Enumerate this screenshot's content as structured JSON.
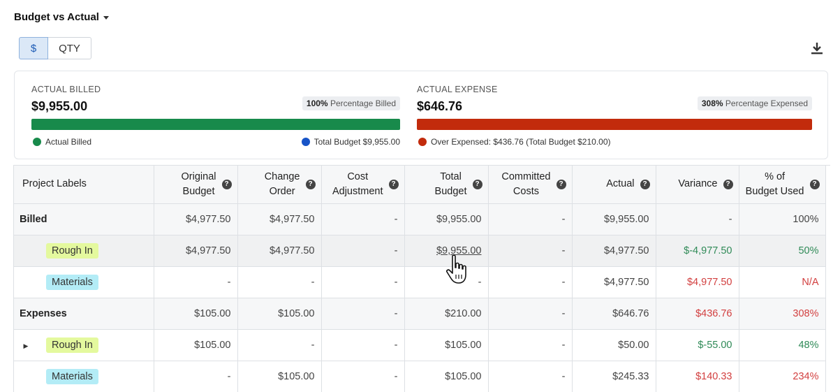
{
  "header": {
    "view_title": "Budget vs Actual"
  },
  "toggle": {
    "dollar_label": "$",
    "qty_label": "QTY",
    "selected": "$"
  },
  "icons": {
    "download": "download-icon",
    "help": "help-icon",
    "cursor": "pointer-hand-icon"
  },
  "summary": {
    "billed": {
      "label": "ACTUAL BILLED",
      "value": "$9,955.00",
      "badge_pct": "100%",
      "badge_text": "Percentage Billed",
      "progress": 1.0,
      "bar_color": "#188a4b",
      "legend_left": "Actual Billed",
      "legend_left_color": "#188a4b",
      "legend_right": "Total Budget $9,955.00",
      "legend_right_color": "#1754c7"
    },
    "expense": {
      "label": "ACTUAL EXPENSE",
      "value": "$646.76",
      "badge_pct": "308%",
      "badge_text": "Percentage Expensed",
      "progress": 1.0,
      "bar_color": "#c22b0c",
      "legend_left": "Over Expensed: $436.76 (Total Budget $210.00)",
      "legend_left_color": "#c22b0c"
    }
  },
  "table": {
    "columns": [
      {
        "label": "Project Labels",
        "help": false
      },
      {
        "label": "Original\nBudget",
        "help": true
      },
      {
        "label": "Change\nOrder",
        "help": true
      },
      {
        "label": "Cost\nAdjustment",
        "help": true
      },
      {
        "label": "Total\nBudget",
        "help": true
      },
      {
        "label": "Committed\nCosts",
        "help": true
      },
      {
        "label": "Actual",
        "help": true
      },
      {
        "label": "Variance",
        "help": true
      },
      {
        "label": "% of\nBudget Used",
        "help": true
      }
    ],
    "rows": [
      {
        "type": "group",
        "label": "Billed",
        "cells": [
          "$4,977.50",
          "$4,977.50",
          "-",
          "$9,955.00",
          "-",
          "$9,955.00",
          "-",
          "100%"
        ],
        "variance_tone": "",
        "pct_tone": ""
      },
      {
        "type": "child",
        "label": "Rough In",
        "tag": "rough",
        "hover": true,
        "link_col": 3,
        "cells": [
          "$4,977.50",
          "$4,977.50",
          "-",
          "$9,955.00",
          "-",
          "$4,977.50",
          "$-4,977.50",
          "50%"
        ],
        "variance_tone": "pos",
        "pct_tone": "pos"
      },
      {
        "type": "child",
        "label": "Materials",
        "tag": "mat",
        "cells": [
          "-",
          "-",
          "-",
          "-",
          "-",
          "$4,977.50",
          "$4,977.50",
          "N/A"
        ],
        "variance_tone": "neg",
        "pct_tone": "neg"
      },
      {
        "type": "group",
        "label": "Expenses",
        "cells": [
          "$105.00",
          "$105.00",
          "-",
          "$210.00",
          "-",
          "$646.76",
          "$436.76",
          "308%"
        ],
        "variance_tone": "neg",
        "pct_tone": "neg"
      },
      {
        "type": "child",
        "label": "Rough In",
        "tag": "rough",
        "expandable": true,
        "cells": [
          "$105.00",
          "-",
          "-",
          "$105.00",
          "-",
          "$50.00",
          "$-55.00",
          "48%"
        ],
        "variance_tone": "pos",
        "pct_tone": "pos"
      },
      {
        "type": "child",
        "label": "Materials",
        "tag": "mat",
        "cells": [
          "-",
          "$105.00",
          "-",
          "$105.00",
          "-",
          "$245.33",
          "$140.33",
          "234%"
        ],
        "variance_tone": "neg",
        "pct_tone": "neg"
      }
    ]
  }
}
